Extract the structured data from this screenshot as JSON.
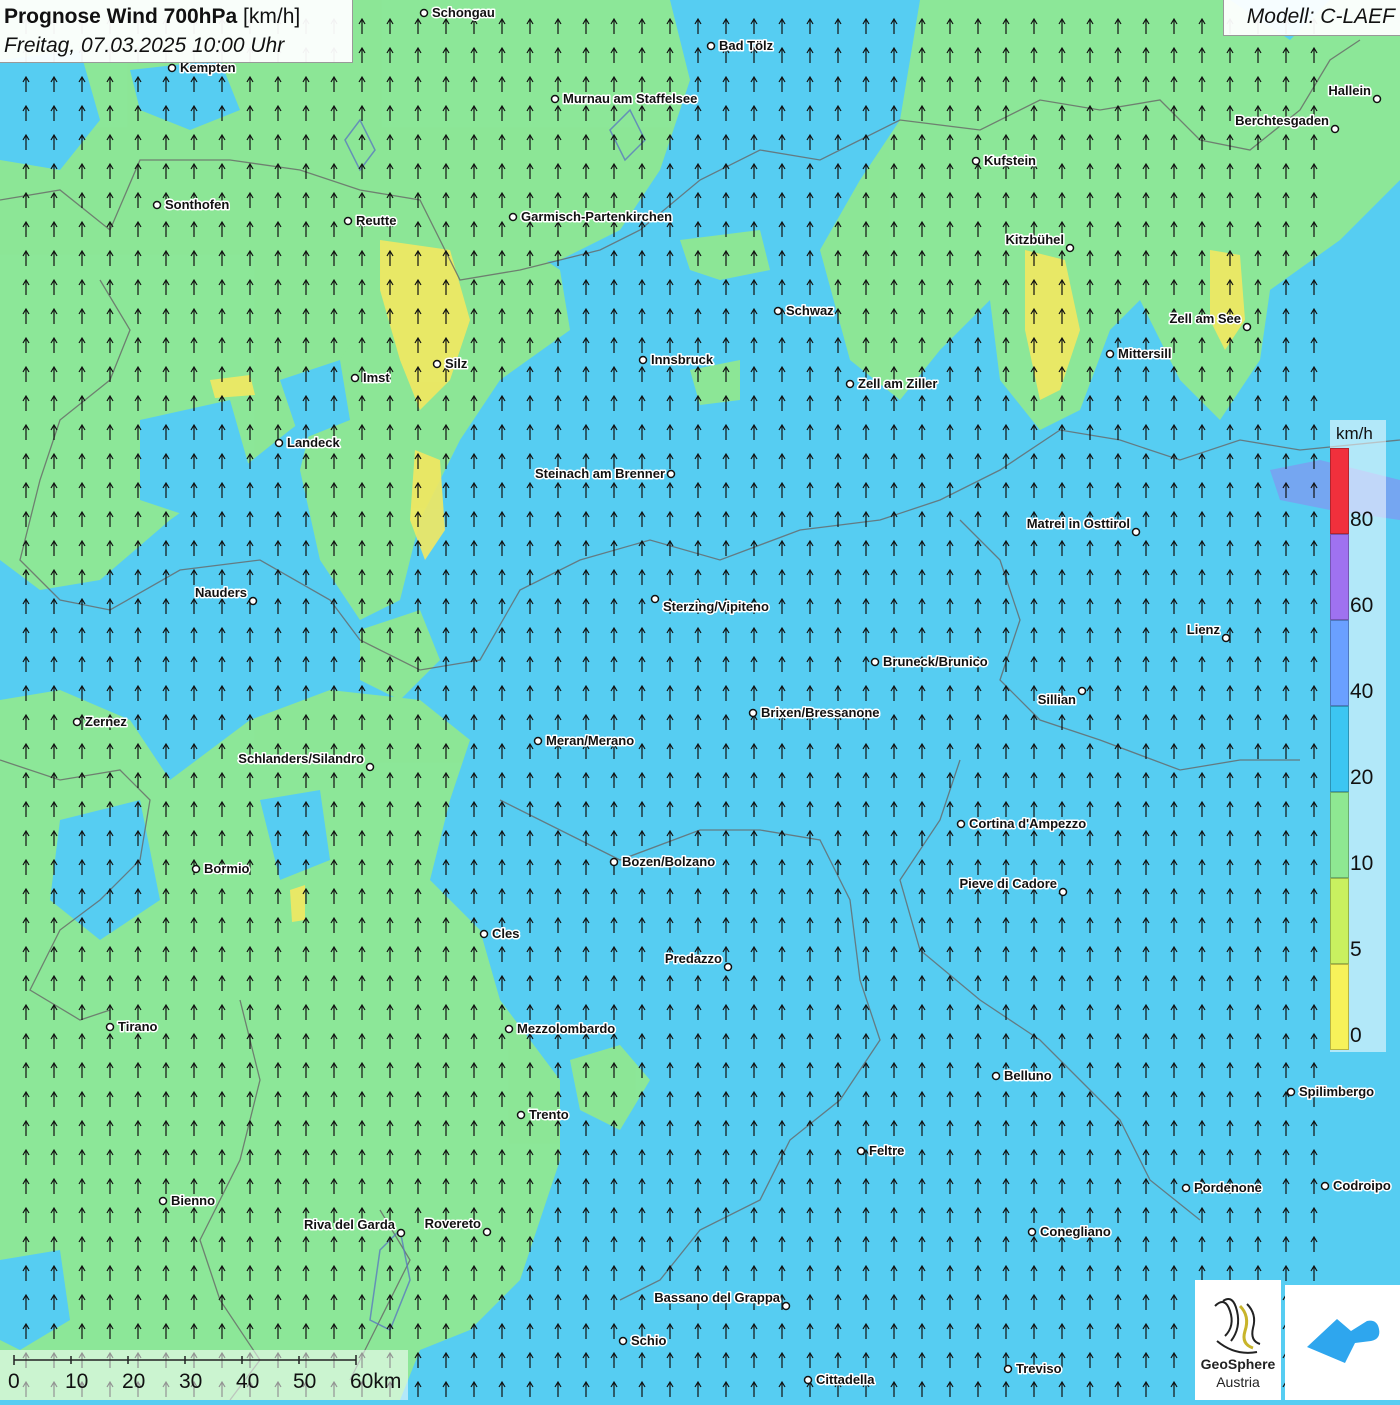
{
  "header": {
    "title_bold": "Prognose Wind 700hPa",
    "title_unit": "[km/h]",
    "datetime": "Freitag, 07.03.2025 10:00 Uhr"
  },
  "model": {
    "label": "Modell: C-LAEF"
  },
  "legend": {
    "unit": "km/h",
    "levels": [
      {
        "label": "80",
        "color": "#f0303c"
      },
      {
        "label": "60",
        "color": "#9f72f0"
      },
      {
        "label": "40",
        "color": "#6aa0ff"
      },
      {
        "label": "20",
        "color": "#3cc6f2"
      },
      {
        "label": "10",
        "color": "#8ee892"
      },
      {
        "label": "5",
        "color": "#c9f060"
      },
      {
        "label": "0",
        "color": "#f7f25a"
      }
    ]
  },
  "scalebar": {
    "labels": [
      "0",
      "10",
      "20",
      "30",
      "40",
      "50",
      "60km"
    ]
  },
  "logo": {
    "name": "GeoSphere",
    "sub": "Austria",
    "icon": "geosphere-logo-icon",
    "app_icon": "weather-app-icon"
  },
  "colors": {
    "calm_yellow": "#f2e860",
    "light_green": "#8fe892",
    "medium_blue": "#56cdf2"
  },
  "wind_direction": "south-to-north (arrows pointing north)",
  "cities": [
    {
      "name": "Schongau"
    },
    {
      "name": "Bad Tölz"
    },
    {
      "name": "Kempten"
    },
    {
      "name": "Murnau am Staffelsee"
    },
    {
      "name": "Hallein"
    },
    {
      "name": "Berchtesgaden"
    },
    {
      "name": "Kufstein"
    },
    {
      "name": "Sonthofen"
    },
    {
      "name": "Reutte"
    },
    {
      "name": "Garmisch-Partenkirchen"
    },
    {
      "name": "Kitzbühel"
    },
    {
      "name": "Schwaz"
    },
    {
      "name": "Zell am See"
    },
    {
      "name": "Silz"
    },
    {
      "name": "Innsbruck"
    },
    {
      "name": "Mittersill"
    },
    {
      "name": "Imst"
    },
    {
      "name": "Zell am Ziller"
    },
    {
      "name": "Landeck"
    },
    {
      "name": "Steinach am Brenner"
    },
    {
      "name": "Matrei in Osttirol"
    },
    {
      "name": "Nauders"
    },
    {
      "name": "Sterzing/Vipiteno"
    },
    {
      "name": "Lienz"
    },
    {
      "name": "Bruneck/Brunico"
    },
    {
      "name": "Sillian"
    },
    {
      "name": "Brixen/Bressanone"
    },
    {
      "name": "Zernez"
    },
    {
      "name": "Meran/Merano"
    },
    {
      "name": "Schlanders/Silandro"
    },
    {
      "name": "Cortina d'Ampezzo"
    },
    {
      "name": "Bozen/Bolzano"
    },
    {
      "name": "Bormio"
    },
    {
      "name": "Pieve di Cadore"
    },
    {
      "name": "Cles"
    },
    {
      "name": "Predazzo"
    },
    {
      "name": "Tirano"
    },
    {
      "name": "Mezzolombardo"
    },
    {
      "name": "Belluno"
    },
    {
      "name": "Spilimbergo"
    },
    {
      "name": "Trento"
    },
    {
      "name": "Feltre"
    },
    {
      "name": "Bienno"
    },
    {
      "name": "Pordenone"
    },
    {
      "name": "Codroipo"
    },
    {
      "name": "Riva del Garda"
    },
    {
      "name": "Rovereto"
    },
    {
      "name": "Conegliano"
    },
    {
      "name": "Bassano del Grappa"
    },
    {
      "name": "Schio"
    },
    {
      "name": "Treviso"
    },
    {
      "name": "Cittadella"
    }
  ]
}
